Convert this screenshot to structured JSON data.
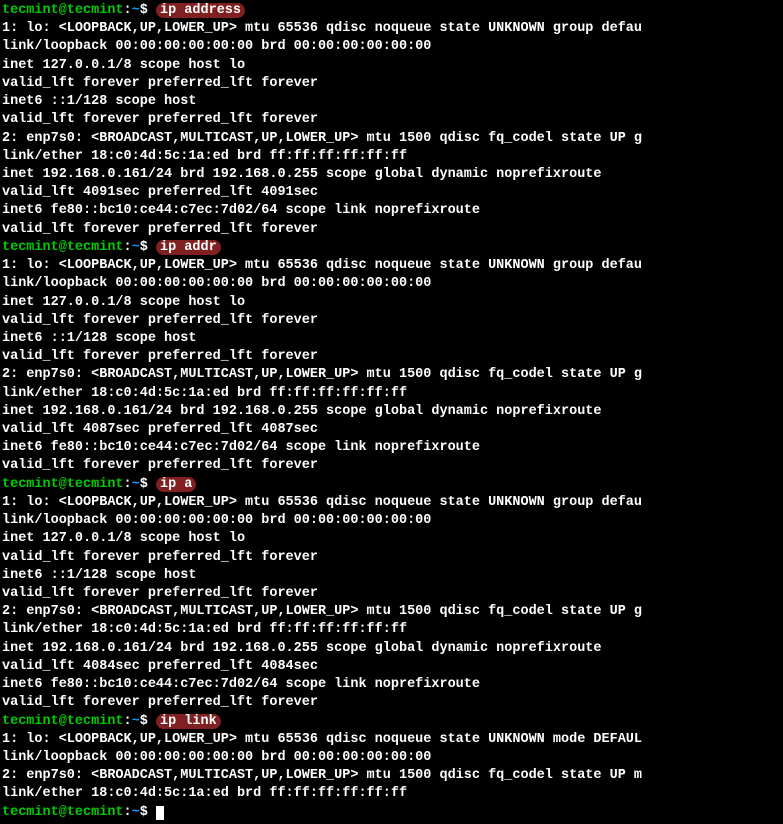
{
  "prompt": {
    "user": "tecmint",
    "at": "@",
    "host": "tecmint",
    "colon": ":",
    "path": "~",
    "dollar": "$"
  },
  "cmd1": "ip address",
  "cmd2": "ip addr",
  "cmd3": "ip a",
  "cmd4": "ip link",
  "out": {
    "lo_hdr": "1: lo: <LOOPBACK,UP,LOWER_UP> mtu 65536 qdisc noqueue state UNKNOWN group defau",
    "lo_link": "    link/loopback 00:00:00:00:00:00 brd 00:00:00:00:00:00",
    "lo_inet": "    inet 127.0.0.1/8 scope host lo",
    "valid_forever": "       valid_lft forever preferred_lft forever",
    "lo_inet6": "    inet6 ::1/128 scope host",
    "enp_hdr": "2: enp7s0: <BROADCAST,MULTICAST,UP,LOWER_UP> mtu 1500 qdisc fq_codel state UP g",
    "enp_link": "    link/ether 18:c0:4d:5c:1a:ed brd ff:ff:ff:ff:ff:ff",
    "enp_inet": "    inet 192.168.0.161/24 brd 192.168.0.255 scope global dynamic noprefixroute",
    "valid_4091": "       valid_lft 4091sec preferred_lft 4091sec",
    "valid_4087": "       valid_lft 4087sec preferred_lft 4087sec",
    "valid_4084": "       valid_lft 4084sec preferred_lft 4084sec",
    "enp_inet6": "    inet6 fe80::bc10:ce44:c7ec:7d02/64 scope link noprefixroute",
    "link_lo": "1: lo: <LOOPBACK,UP,LOWER_UP> mtu 65536 qdisc noqueue state UNKNOWN mode DEFAUL",
    "link_enp": "2: enp7s0: <BROADCAST,MULTICAST,UP,LOWER_UP> mtu 1500 qdisc fq_codel state UP m"
  }
}
